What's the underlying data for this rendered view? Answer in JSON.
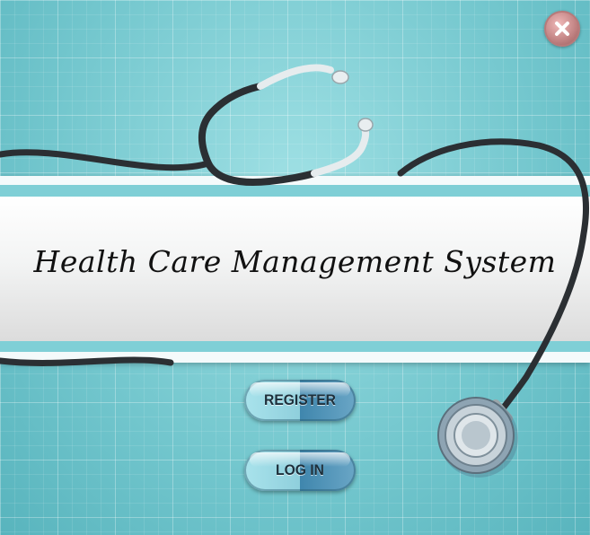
{
  "app": {
    "title": "Health Care Management System"
  },
  "buttons": {
    "register": "REGISTER",
    "login": "LOG IN"
  },
  "icons": {
    "close": "close-icon",
    "stethoscope": "stethoscope-icon"
  },
  "colors": {
    "background": "#7fd0d6",
    "stripe": "#7fcfd6",
    "close_button": "#c48686",
    "button_dark": "#3f86ad",
    "button_light": "#a9e3ec"
  }
}
